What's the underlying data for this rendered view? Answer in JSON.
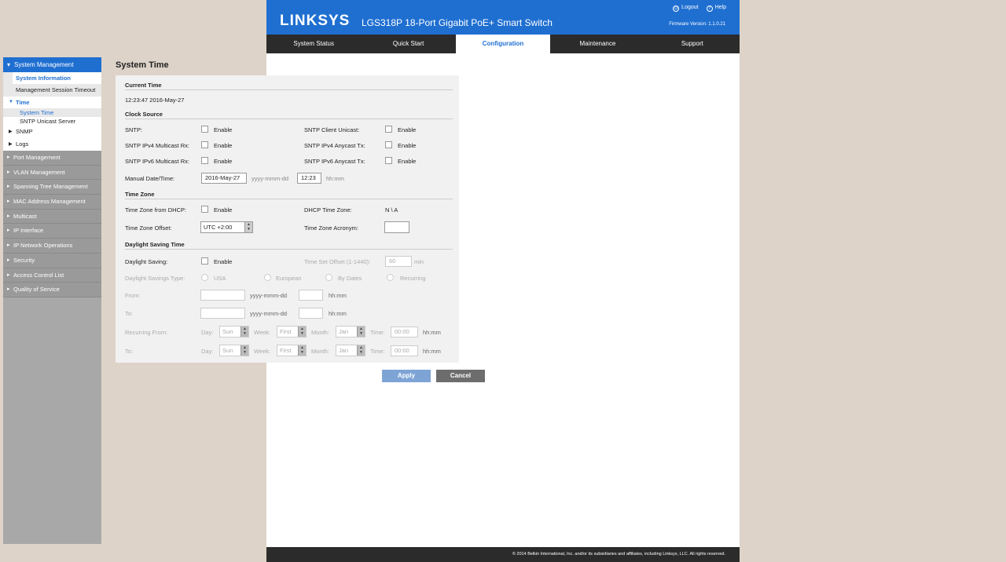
{
  "header": {
    "logo": "LINKSYS",
    "product": "LGS318P 18-Port Gigabit PoE+ Smart Switch",
    "logout": "Logout",
    "help": "Help",
    "firmware": "Firmware Version: 1.1.0.21"
  },
  "nav": {
    "tabs": [
      "System Status",
      "Quick Start",
      "Configuration",
      "Maintenance",
      "Support"
    ],
    "active": "Configuration"
  },
  "sidebar": {
    "head": "System Management",
    "system_information": "System Information",
    "session_timeout": "Management Session Timeout",
    "time": "Time",
    "system_time": "System Time",
    "sntp_unicast": "SNTP Unicast Server",
    "snmp": "SNMP",
    "logs": "Logs",
    "groups": [
      "Port Management",
      "VLAN Management",
      "Spanning Tree Management",
      "MAC Address Management",
      "Multicast",
      "IP Interface",
      "IP Network Operations",
      "Security",
      "Access Control List",
      "Quality of Service"
    ]
  },
  "page": {
    "title": "System Time",
    "current_time_heading": "Current Time",
    "current_time_value": "12:23:47 2016-May-27",
    "clock_source_heading": "Clock Source",
    "sntp": "SNTP:",
    "sntp_client_unicast": "SNTP Client Unicast:",
    "ipv4_multicast": "SNTP IPv4 Multicast Rx:",
    "ipv4_anycast": "SNTP IPv4 Anycast Tx:",
    "ipv6_multicast": "SNTP IPv6 Multicast Rx:",
    "ipv6_anycast": "SNTP IPv6 Anycast Tx:",
    "enable": "Enable",
    "manual_datetime": "Manual Date/Time:",
    "manual_date_value": "2016-May-27",
    "date_format": "yyyy-mmm-dd",
    "manual_time_value": "12:23",
    "time_format": "hh:mm",
    "time_zone_heading": "Time Zone",
    "tz_from_dhcp": "Time Zone from DHCP:",
    "dhcp_time_zone": "DHCP Time Zone:",
    "dhcp_time_zone_value": "N \\ A",
    "tz_offset": "Time Zone Offset:",
    "tz_offset_value": "UTC +2:00",
    "tz_acronym": "Time Zone Acronym:",
    "tz_acronym_value": "",
    "dst_heading": "Daylight Saving Time",
    "daylight_saving": "Daylight Saving:",
    "time_set_offset": "Time Set Offset (1-1440):",
    "time_set_offset_value": "60",
    "min": "min",
    "dst_type": "Daylight Savings Type:",
    "usa": "USA",
    "european": "European",
    "by_dates": "By Dates",
    "recurring": "Recurring",
    "from": "From:",
    "to": "To:",
    "recurring_from": "Recurring From:",
    "day": "Day:",
    "day_value": "Sun",
    "week": "Week:",
    "week_value": "First",
    "month": "Month:",
    "month_value": "Jan",
    "time": "Time:",
    "time_value": "00:00"
  },
  "buttons": {
    "apply": "Apply",
    "cancel": "Cancel"
  },
  "footer": "© 2014 Belkin International, Inc. and/or its subsidiaries and affiliates, including Linksys, LLC. All rights reserved.",
  "colors": {
    "brand": "#1f6fd1",
    "nav_bg": "#2b2b2b",
    "apply": "#7ea4d6",
    "cancel": "#6d6d6d"
  }
}
